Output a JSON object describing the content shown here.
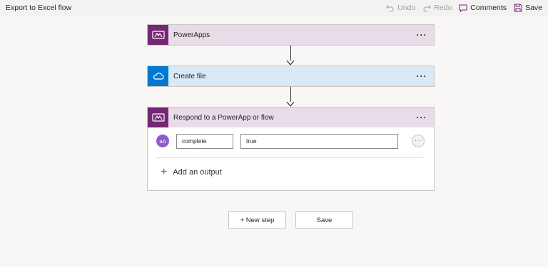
{
  "topbar": {
    "title": "Export to Excel flow",
    "undo_label": "Undo",
    "redo_label": "Redo",
    "comments_label": "Comments",
    "save_label": "Save"
  },
  "steps": [
    {
      "title": "PowerApps",
      "more": "···",
      "color": "#e8dce9",
      "icon_bg": "#742774",
      "icon": "powerapps-icon"
    },
    {
      "title": "Create file",
      "more": "···",
      "color": "#d9e9f6",
      "icon_bg": "#0078d4",
      "icon": "onedrive-cloud-icon"
    },
    {
      "title": "Respond to a PowerApp or flow",
      "more": "···",
      "color": "#e8dce9",
      "icon_bg": "#742774",
      "icon": "powerapps-icon"
    }
  ],
  "respond": {
    "output": {
      "avatar_text": "aA",
      "name": "complete",
      "value": "true",
      "more": "···"
    },
    "add_output_label": "Add an output"
  },
  "buttons": {
    "new_step": "+ New step",
    "save": "Save"
  }
}
